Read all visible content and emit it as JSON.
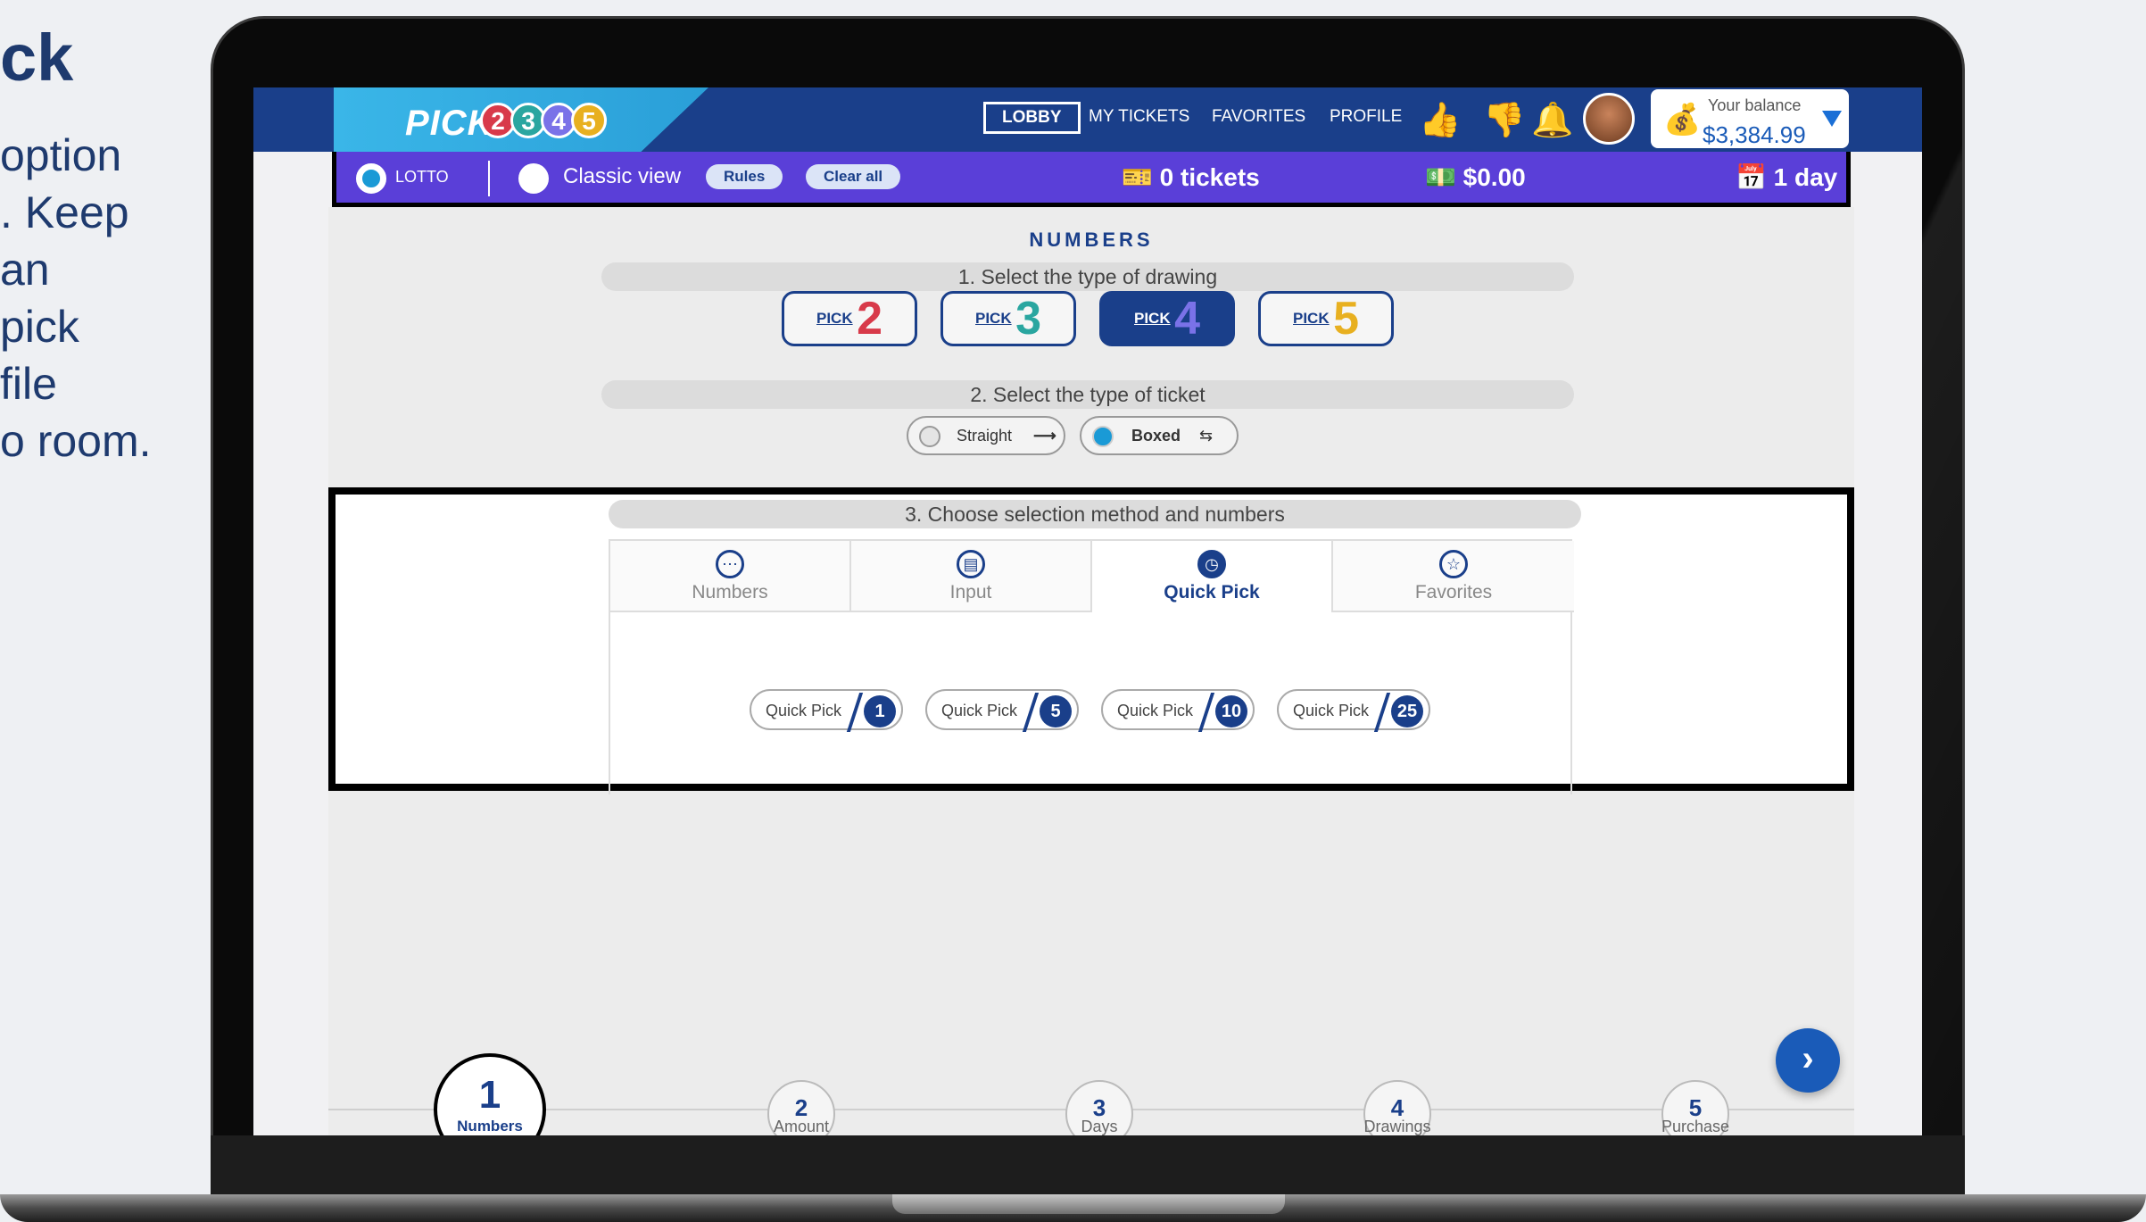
{
  "slide": {
    "title": "ck",
    "body_lines": [
      "option",
      ". Keep",
      "an",
      "pick",
      "file",
      "o room."
    ]
  },
  "header": {
    "logo_text": "PICK",
    "logo_balls": [
      "2",
      "3",
      "4",
      "5"
    ],
    "nav": [
      "LOBBY",
      "MY TICKETS",
      "FAVORITES",
      "PROFILE"
    ],
    "balance_label": "Your balance",
    "balance_value": "$3,384.99"
  },
  "toolbar": {
    "lotto_label": "LOTTO",
    "classic_view": "Classic view",
    "rules": "Rules",
    "clear_all": "Clear all",
    "tickets": "0 tickets",
    "amount": "$0.00",
    "days": "1 day"
  },
  "numbers": {
    "title": "NUMBERS",
    "step1": "1. Select the type of drawing",
    "draw_types": [
      {
        "pick": "PICK",
        "num": "2",
        "color": "#d83a4a"
      },
      {
        "pick": "PICK",
        "num": "3",
        "color": "#2aa6a0"
      },
      {
        "pick": "PICK",
        "num": "4",
        "color": "#7a72e8"
      },
      {
        "pick": "PICK",
        "num": "5",
        "color": "#e8b020"
      }
    ],
    "step2": "2. Select the type of ticket",
    "ticket_types": [
      "Straight",
      "Boxed"
    ],
    "step3": "3. Choose selection method and numbers",
    "tabs": [
      "Numbers",
      "Input",
      "Quick Pick",
      "Favorites"
    ],
    "quick_picks": [
      {
        "label": "Quick Pick",
        "count": "1"
      },
      {
        "label": "Quick Pick",
        "count": "5"
      },
      {
        "label": "Quick Pick",
        "count": "10"
      },
      {
        "label": "Quick Pick",
        "count": "25"
      }
    ]
  },
  "steps": [
    {
      "num": "1",
      "label": "Numbers"
    },
    {
      "num": "2",
      "label": "Amount"
    },
    {
      "num": "3",
      "label": "Days"
    },
    {
      "num": "4",
      "label": "Drawings"
    },
    {
      "num": "5",
      "label": "Purchase"
    }
  ],
  "colors": {
    "brand": "#1a3f8a",
    "toolbar": "#5a3fd8",
    "accent": "#1a9ad6"
  }
}
